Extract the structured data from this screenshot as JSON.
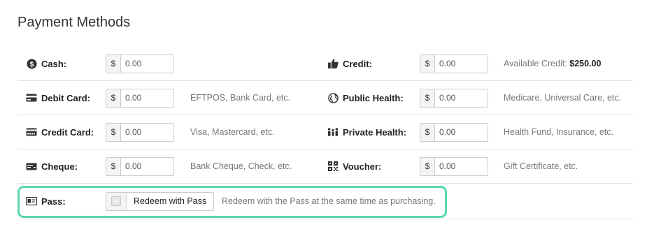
{
  "page": {
    "title": "Payment Methods"
  },
  "currency_symbol": "$",
  "rows": {
    "cash": {
      "label": "Cash:",
      "value": "0.00",
      "icon": "dollar-circle-icon"
    },
    "credit": {
      "label": "Credit:",
      "value": "0.00",
      "icon": "thumbs-up-icon",
      "hint_prefix": "Available Credit:",
      "hint_amount": "$250.00"
    },
    "debit": {
      "label": "Debit Card:",
      "value": "0.00",
      "icon": "debit-card-icon",
      "hint": "EFTPOS, Bank Card, etc."
    },
    "public_health": {
      "label": "Public Health:",
      "value": "0.00",
      "icon": "globe-icon",
      "hint": "Medicare, Universal Care, etc."
    },
    "credit_card": {
      "label": "Credit Card:",
      "value": "0.00",
      "icon": "credit-card-icon",
      "hint": "Visa, Mastercard, etc."
    },
    "private_health": {
      "label": "Private Health:",
      "value": "0.00",
      "icon": "family-icon",
      "hint": "Health Fund, Insurance, etc."
    },
    "cheque": {
      "label": "Cheque:",
      "value": "0.00",
      "icon": "cheque-icon",
      "hint": "Bank Cheque, Check, etc."
    },
    "voucher": {
      "label": "Voucher:",
      "value": "0.00",
      "icon": "qr-voucher-icon",
      "hint": "Gift Certificate, etc."
    }
  },
  "pass": {
    "label": "Pass:",
    "icon": "id-card-icon",
    "button_label": "Redeem with Pass",
    "hint": "Redeem with the Pass at the same time as purchasing.",
    "highlight_color": "#5ad6b4"
  }
}
